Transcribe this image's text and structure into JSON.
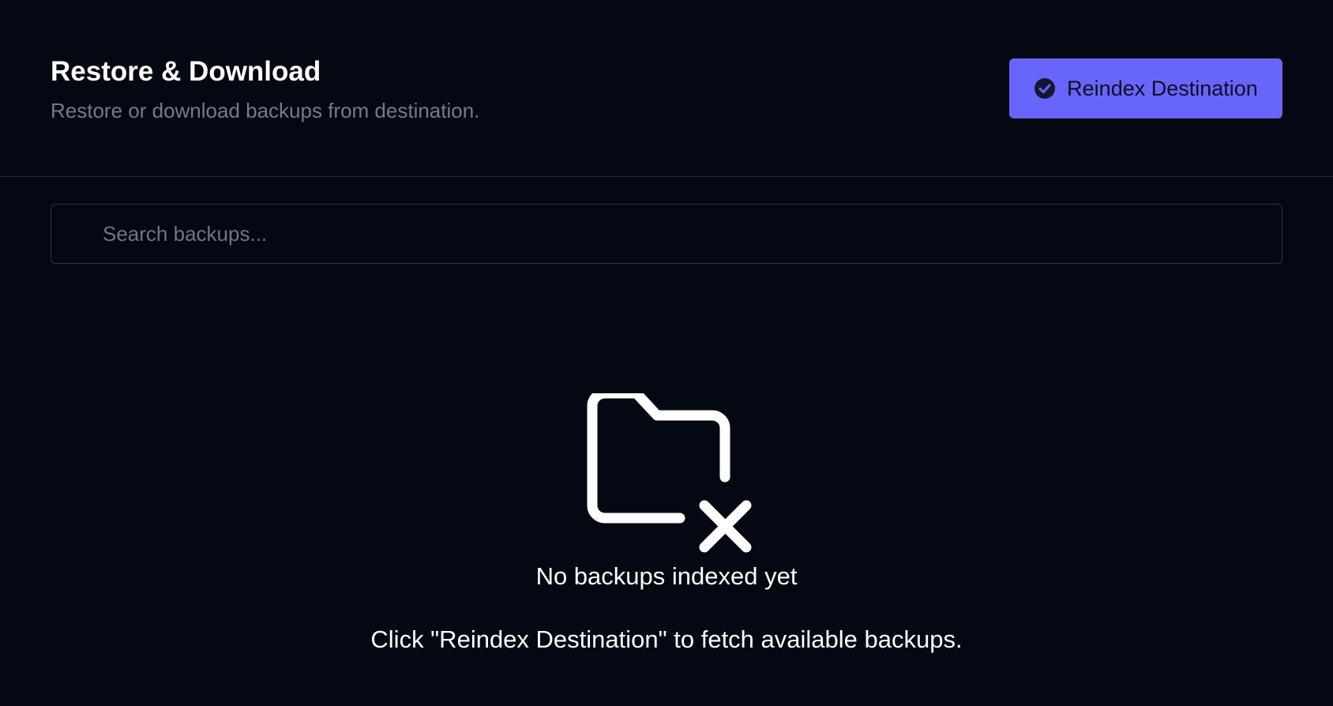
{
  "header": {
    "title": "Restore & Download",
    "subtitle": "Restore or download backups from destination.",
    "reindex_button": {
      "label": "Reindex Destination",
      "icon": "check-circle-icon"
    }
  },
  "search": {
    "placeholder": "Search backups...",
    "value": ""
  },
  "empty_state": {
    "icon": "folder-x-icon",
    "title": "No backups indexed yet",
    "hint": "Click \"Reindex Destination\" to fetch available backups."
  },
  "colors": {
    "background": "#040812",
    "accent": "#6865fb",
    "muted_text": "#747a87",
    "divider": "#262b38"
  }
}
